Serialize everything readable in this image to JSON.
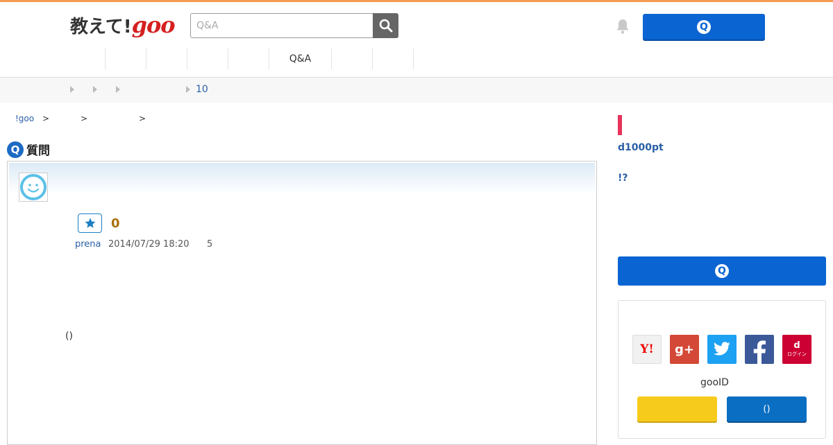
{
  "header": {
    "logo_text": "教えて!",
    "logo_goo": "goo",
    "search_placeholder": "Q&A",
    "ask_icon_letter": "Q"
  },
  "category_nav": [
    "",
    "",
    "",
    "",
    "",
    "Q&A",
    "",
    ""
  ],
  "subbar": {
    "count": "10"
  },
  "breadcrumb": {
    "home": "!goo",
    "sep": ">"
  },
  "question": {
    "heading_letter": "Q",
    "heading": "質問",
    "star_count": "0",
    "user": "prena",
    "date": "2014/07/29 18:20",
    "answer_count": "5",
    "body_text": "()"
  },
  "sidebar": {
    "title1": "d1000pt",
    "title2": "!?",
    "ask_icon_letter": "Q",
    "login": {
      "yahoo_text": "Y!",
      "gplus_text": "g+",
      "docomo_letter": "d",
      "docomo_text": "ログイン",
      "gooid_label": "gooID",
      "yellow_btn_label": "",
      "blue_btn_label": "()"
    }
  },
  "colors": {
    "accent_top": "#f39b50",
    "primary_blue": "#0a64d2",
    "link": "#2a5fa5",
    "side_marker": "#e8335a"
  }
}
